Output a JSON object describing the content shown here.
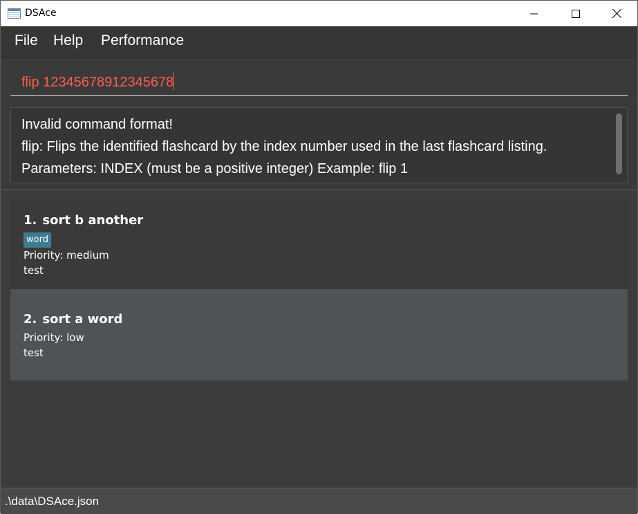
{
  "window": {
    "title": "DSAce",
    "app_icon": "window-app-icon",
    "controls": {
      "minimize": "minimize-icon",
      "maximize": "maximize-icon",
      "close": "close-icon"
    }
  },
  "menu": {
    "items": [
      {
        "label": "File"
      },
      {
        "label": "Help"
      },
      {
        "label": "Performance"
      }
    ]
  },
  "command_box": {
    "value": "flip 12345678912345678",
    "text_color": "#ff5d4d"
  },
  "result_display": {
    "lines": [
      "Invalid command format!",
      "flip: Flips the identified flashcard by the index number used in the last flashcard listing.",
      "Parameters: INDEX (must be a positive integer) Example: flip 1"
    ]
  },
  "flashcards": [
    {
      "index": "1.",
      "title": "sort b another",
      "tag": "word",
      "priority": "Priority: medium",
      "note": "test"
    },
    {
      "index": "2.",
      "title": "sort a word",
      "priority": "Priority: low",
      "note": "test"
    }
  ],
  "status_bar": {
    "path": ".\\data\\DSAce.json"
  },
  "colors": {
    "background": "#3c3c3c",
    "tag_background": "#3e7b91",
    "selected_card": "#4f5356"
  }
}
